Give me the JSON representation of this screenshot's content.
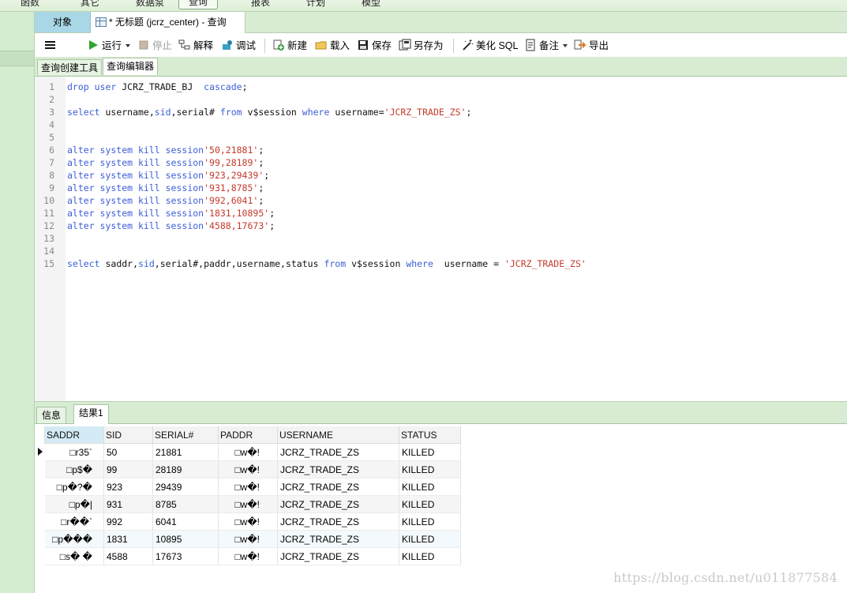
{
  "menu": {
    "items": [
      "函数",
      "其它",
      "数据泵",
      "查询",
      "报表",
      "计划",
      "模型"
    ],
    "active_index": 3
  },
  "tabs": {
    "objects_label": "对象",
    "query_label": "* 无标题 (jcrz_center) - 查询"
  },
  "toolbar": {
    "run": "运行",
    "stop": "停止",
    "explain": "解释",
    "debug": "调试",
    "new": "新建",
    "load": "载入",
    "save": "保存",
    "save_as": "另存为",
    "beautify": "美化 SQL",
    "note": "备注",
    "export": "导出"
  },
  "subtabs": {
    "builder": "查询创建工具",
    "editor": "查询编辑器"
  },
  "editor": {
    "lines": [
      {
        "n": "1",
        "tokens": [
          {
            "t": "drop user",
            "c": "kw"
          },
          {
            "t": " JCRZ_TRADE_BJ  ",
            "c": "idt"
          },
          {
            "t": "cascade",
            "c": "kw"
          },
          {
            "t": ";",
            "c": "idt"
          }
        ]
      },
      {
        "n": "2",
        "tokens": []
      },
      {
        "n": "3",
        "tokens": [
          {
            "t": "select",
            "c": "kw"
          },
          {
            "t": " username,",
            "c": "idt"
          },
          {
            "t": "sid",
            "c": "kw"
          },
          {
            "t": ",serial# ",
            "c": "idt"
          },
          {
            "t": "from",
            "c": "kw"
          },
          {
            "t": " v$session ",
            "c": "idt"
          },
          {
            "t": "where",
            "c": "kw"
          },
          {
            "t": " username=",
            "c": "idt"
          },
          {
            "t": "'JCRZ_TRADE_ZS'",
            "c": "str"
          },
          {
            "t": ";",
            "c": "idt"
          }
        ]
      },
      {
        "n": "4",
        "tokens": []
      },
      {
        "n": "5",
        "tokens": []
      },
      {
        "n": "6",
        "tokens": [
          {
            "t": "alter system kill session",
            "c": "kw"
          },
          {
            "t": "'50,21881'",
            "c": "str"
          },
          {
            "t": ";",
            "c": "idt"
          }
        ]
      },
      {
        "n": "7",
        "tokens": [
          {
            "t": "alter system kill session",
            "c": "kw"
          },
          {
            "t": "'99,28189'",
            "c": "str"
          },
          {
            "t": ";",
            "c": "idt"
          }
        ]
      },
      {
        "n": "8",
        "tokens": [
          {
            "t": "alter system kill session",
            "c": "kw"
          },
          {
            "t": "'923,29439'",
            "c": "str"
          },
          {
            "t": ";",
            "c": "idt"
          }
        ]
      },
      {
        "n": "9",
        "tokens": [
          {
            "t": "alter system kill session",
            "c": "kw"
          },
          {
            "t": "'931,8785'",
            "c": "str"
          },
          {
            "t": ";",
            "c": "idt"
          }
        ]
      },
      {
        "n": "10",
        "tokens": [
          {
            "t": "alter system kill session",
            "c": "kw"
          },
          {
            "t": "'992,6041'",
            "c": "str"
          },
          {
            "t": ";",
            "c": "idt"
          }
        ]
      },
      {
        "n": "11",
        "tokens": [
          {
            "t": "alter system kill session",
            "c": "kw"
          },
          {
            "t": "'1831,10895'",
            "c": "str"
          },
          {
            "t": ";",
            "c": "idt"
          }
        ]
      },
      {
        "n": "12",
        "tokens": [
          {
            "t": "alter system kill session",
            "c": "kw"
          },
          {
            "t": "'4588,17673'",
            "c": "str"
          },
          {
            "t": ";",
            "c": "idt"
          }
        ]
      },
      {
        "n": "13",
        "tokens": []
      },
      {
        "n": "14",
        "tokens": []
      },
      {
        "n": "15",
        "tokens": [
          {
            "t": "select",
            "c": "kw"
          },
          {
            "t": " saddr,",
            "c": "idt"
          },
          {
            "t": "sid",
            "c": "kw"
          },
          {
            "t": ",serial#,paddr,username,status ",
            "c": "idt"
          },
          {
            "t": "from",
            "c": "kw"
          },
          {
            "t": " v$session ",
            "c": "idt"
          },
          {
            "t": "where",
            "c": "kw"
          },
          {
            "t": "  username = ",
            "c": "idt"
          },
          {
            "t": "'JCRZ_TRADE_ZS'",
            "c": "str"
          }
        ]
      }
    ]
  },
  "result_tabs": {
    "info": "信息",
    "result1": "结果1"
  },
  "results": {
    "columns": [
      "SADDR",
      "SID",
      "SERIAL#",
      "PADDR",
      "USERNAME",
      "STATUS"
    ],
    "rows": [
      [
        "□r35`",
        "50",
        "21881",
        "□w�!",
        "JCRZ_TRADE_ZS",
        "KILLED"
      ],
      [
        "□p$�",
        "99",
        "28189",
        "□w�!",
        "JCRZ_TRADE_ZS",
        "KILLED"
      ],
      [
        "□p�?�",
        "923",
        "29439",
        "□w�!",
        "JCRZ_TRADE_ZS",
        "KILLED"
      ],
      [
        "□p�|",
        "931",
        "8785",
        "□w�!",
        "JCRZ_TRADE_ZS",
        "KILLED"
      ],
      [
        "□r��`",
        "992",
        "6041",
        "□w�!",
        "JCRZ_TRADE_ZS",
        "KILLED"
      ],
      [
        "□p���",
        "1831",
        "10895",
        "□w�!",
        "JCRZ_TRADE_ZS",
        "KILLED"
      ],
      [
        "□s� �",
        "4588",
        "17673",
        "□w�!",
        "JCRZ_TRADE_ZS",
        "KILLED"
      ]
    ],
    "current_row": 0
  },
  "watermark": "https://blog.csdn.net/u011877584",
  "colors": {
    "accent_green": "#d7ecd2",
    "objects_tab": "#a9d7e6",
    "keyword": "#3d5ed8",
    "string": "#c43a2c"
  }
}
